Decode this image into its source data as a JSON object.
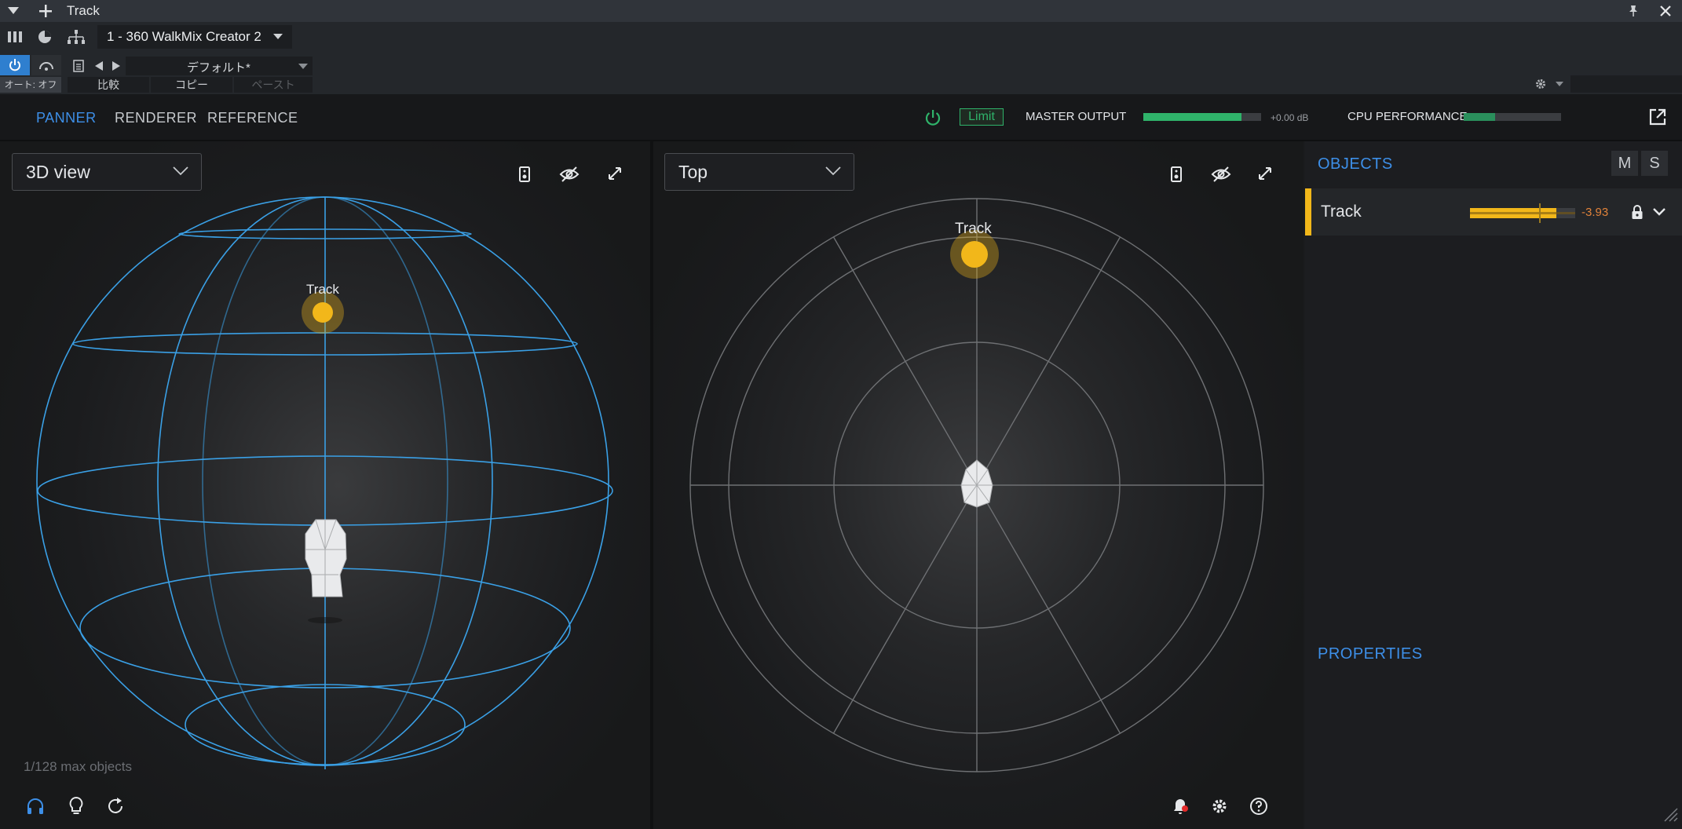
{
  "titlebar": {
    "title": "Track"
  },
  "host": {
    "preset_name": "1 - 360 WalkMix Creator 2",
    "auto_label": "オート: オフ",
    "preset_field": "デフォルト*",
    "compare_label": "比較",
    "copy_label": "コピー",
    "paste_label": "ペースト"
  },
  "plugin": {
    "tabs": [
      {
        "label": "PANNER",
        "active": true
      },
      {
        "label": "RENDERER",
        "active": false
      },
      {
        "label": "REFERENCE",
        "active": false
      }
    ],
    "limit_label": "Limit",
    "master_output_label": "MASTER OUTPUT",
    "master_db": "+0.00 dB",
    "master_level": 0.83,
    "cpu_label": "CPU PERFORMANCE",
    "cpu_level": 0.32,
    "accent": "#3d8fe8",
    "meter_color": "#2fb36a"
  },
  "view3d": {
    "dropdown": "3D view",
    "object_label": "Track",
    "max_objects": "1/128 max objects",
    "sphere_color": "#3aa0e6"
  },
  "viewtop": {
    "dropdown": "Top",
    "object_label": "Track",
    "object_color": "#f2b71a"
  },
  "objects": {
    "title": "OBJECTS",
    "mute_label": "M",
    "solo_label": "S",
    "items": [
      {
        "name": "Track",
        "level_db": "-3.93",
        "level": 0.82,
        "color": "#f2b71a"
      }
    ]
  },
  "properties": {
    "title": "PROPERTIES"
  },
  "icons": [
    "menu-arrow-icon",
    "plus-icon",
    "pin-icon",
    "close-icon",
    "bypass-icon",
    "link-icon",
    "settings-gear-icon",
    "speaker-icon",
    "visibility-off-icon",
    "expand-icon",
    "headphones-icon",
    "lightbulb-icon",
    "reset-icon",
    "notification-icon",
    "help-icon",
    "popout-icon",
    "lock-icon",
    "chevron-down-icon",
    "power-icon"
  ]
}
